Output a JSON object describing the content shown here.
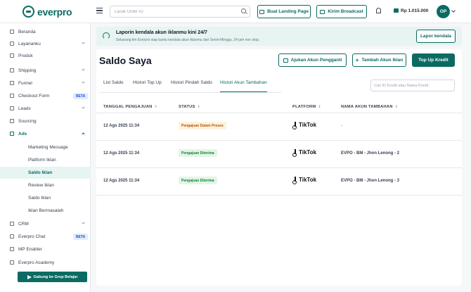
{
  "header": {
    "logo_text": "everpro",
    "search_placeholder": "Lacak Order ID",
    "btn_landing": "Buat Landing Page",
    "btn_broadcast": "Kirim Broadcast",
    "balance": "Rp 1.015.000",
    "avatar_initials": "OP"
  },
  "sidebar": {
    "items": [
      {
        "label": "Beranda"
      },
      {
        "label": "Layananku"
      },
      {
        "label": "Produk"
      },
      {
        "label": "Shipping"
      },
      {
        "label": "Funnel"
      },
      {
        "label": "Checkout Form",
        "badge": "BETA"
      },
      {
        "label": "Leads"
      },
      {
        "label": "Sourcing"
      },
      {
        "label": "Ads"
      }
    ],
    "ads_sub": [
      {
        "label": "Marketing Message"
      },
      {
        "label": "Platform Iklan"
      },
      {
        "label": "Saldo Iklan"
      },
      {
        "label": "Review Iklan"
      },
      {
        "label": "Saldo Iklan"
      },
      {
        "label": "Iklan Bermasalah"
      }
    ],
    "bottom_items": [
      {
        "label": "CRM"
      },
      {
        "label": "Everpro Chat",
        "badge": "BETA"
      },
      {
        "label": "MP Enabler"
      },
      {
        "label": "Everpro Academy"
      }
    ],
    "join_button": "Gabung ke Grup Belajar"
  },
  "notice": {
    "title": "Laporin kendala akun iklanmu kini 24/7",
    "subtitle": "Sekarang tim Everpro siap bantu kendala akun iklanmu dari Senin-Minggu, 24 jam non stop.",
    "button": "Lapor kendala"
  },
  "page": {
    "title": "Saldo Saya",
    "btn_ajukan": "Ajukan Akun Pengganti",
    "btn_tambah": "Tambah Akun Iklan",
    "btn_topup": "Top Up Kredit",
    "tabs": [
      "List Saldo",
      "Histori Top Up",
      "Histori Pindah Saldo",
      "Histori Akun Tambahan"
    ],
    "search_placeholder": "Cari ID Kredit atau Nama Kredit"
  },
  "table": {
    "columns": [
      "TANGGAL PENGAJUAN",
      "STATUS",
      "PLATFORM",
      "NAMA AKUN TAMBAHAN"
    ],
    "rows": [
      {
        "date": "12 Ags 2025 11:34",
        "status": "Pengajuan Dalam Proses",
        "status_type": "warn",
        "platform": "TikTok",
        "account": "-"
      },
      {
        "date": "12 Ags 2025 11:34",
        "status": "Pengajuan Diterima",
        "status_type": "ok",
        "platform": "TikTok",
        "account": "EVPO - BM - Jhon Lenong - 2"
      },
      {
        "date": "12 Ags 2025 11:34",
        "status": "Pengajuan Diterima",
        "status_type": "ok",
        "platform": "TikTok",
        "account": "EVPO - BM - Jhon Lenong - 3"
      }
    ]
  },
  "colors": {
    "brand": "#0b6b63",
    "warn_bg": "#fdf3dc",
    "ok_bg": "#e3f5e6"
  }
}
